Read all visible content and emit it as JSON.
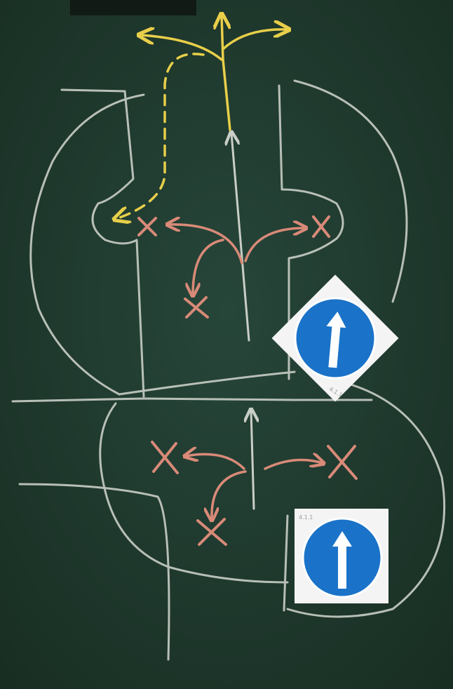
{
  "colors": {
    "board": "#23402f",
    "board_dark": "#17291f",
    "chalk_white": "#c9cec6",
    "chalk_yellow": "#e8cf4a",
    "chalk_red": "#d98a78",
    "sign_blue": "#1a73c8",
    "sign_card": "#f4f4f4"
  },
  "icons": {
    "top_sign": "straight-only-arrow-icon",
    "bottom_sign": "straight-only-arrow-icon",
    "forbidden": "x-cross-icon"
  },
  "signs": {
    "top_code": "4.1.1",
    "bottom_code": "4.1.1"
  }
}
